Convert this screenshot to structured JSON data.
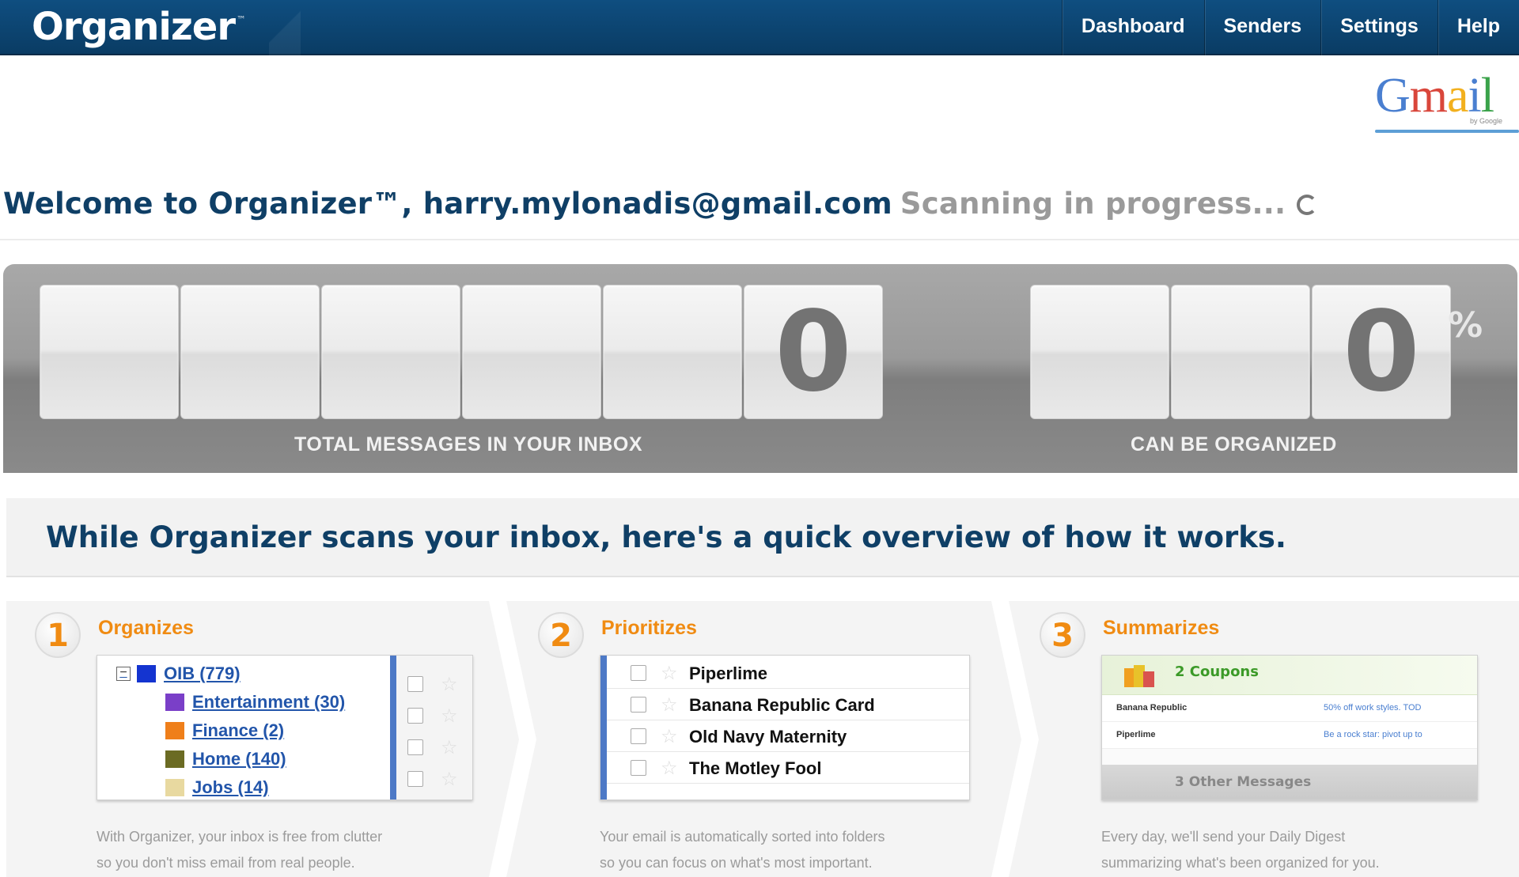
{
  "header": {
    "logo": "Organizer",
    "logo_tm": "™",
    "nav": [
      "Dashboard",
      "Senders",
      "Settings",
      "Help"
    ]
  },
  "gmail_logo": {
    "text": "Gmail",
    "sub": "by Google"
  },
  "welcome": {
    "text": "Welcome to Organizer™, harry.mylonadis@gmail.com",
    "status": "Scanning in progress..."
  },
  "counters": {
    "total": {
      "digits": [
        "",
        "",
        "",
        "",
        "",
        "0"
      ],
      "label": "TOTAL MESSAGES IN YOUR INBOX"
    },
    "organized": {
      "digits": [
        "",
        "",
        "0"
      ],
      "unit": "%",
      "label": "CAN BE ORGANIZED"
    }
  },
  "overview": {
    "text": "While Organizer scans your inbox, here's a quick overview of how it works."
  },
  "steps": [
    {
      "number": "1",
      "title": "Organizes",
      "folders": [
        {
          "label": "OIB (779)",
          "color": "#1434d0"
        },
        {
          "label": "Entertainment (30)",
          "color": "#7a3fc8"
        },
        {
          "label": "Finance (2)",
          "color": "#ef7f1a"
        },
        {
          "label": "Home (140)",
          "color": "#6b6b23"
        },
        {
          "label": "Jobs (14)",
          "color": "#e8d9a0"
        }
      ],
      "desc_lines": [
        "With Organizer, your inbox is free from clutter",
        "so you don't miss email from real people."
      ]
    },
    {
      "number": "2",
      "title": "Prioritizes",
      "senders": [
        "Piperlime",
        "Banana Republic Card",
        "Old Navy Maternity",
        "The Motley Fool"
      ],
      "desc_lines": [
        "Your email is automatically sorted into folders",
        "so you can focus on what's most important."
      ]
    },
    {
      "number": "3",
      "title": "Summarizes",
      "digest_header": "2 Coupons",
      "digest_rows": [
        {
          "sender": "Banana Republic",
          "snippet": "50% off work styles. TOD"
        },
        {
          "sender": "Piperlime",
          "snippet": "Be a rock star: pivot up to"
        }
      ],
      "digest_footer": "3 Other Messages",
      "desc_lines": [
        "Every day, we'll send your Daily Digest",
        "summarizing what's been organized for you."
      ]
    }
  ],
  "colors": {
    "brand_blue": "#0f4e80",
    "heading_blue": "#0f3f66",
    "accent_orange": "#f08b12",
    "link_blue": "#2255aa"
  },
  "icons": {
    "spinner": "spinner-icon",
    "checkbox": "checkbox-icon",
    "star": "star-icon",
    "coupon": "coupon-icon",
    "collapse": "collapse-icon"
  }
}
